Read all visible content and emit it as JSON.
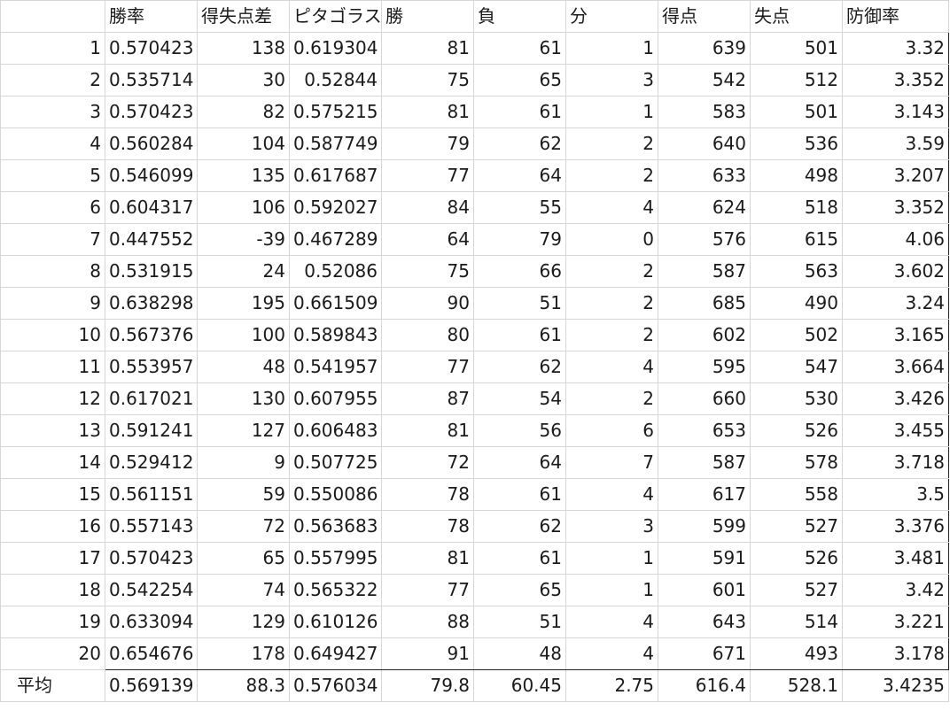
{
  "columns": [
    "勝率",
    "得失点差",
    "ピタゴラス",
    "勝",
    "負",
    "分",
    "得点",
    "失点",
    "防御率"
  ],
  "rows": [
    {
      "label": "1",
      "cells": [
        "0.570423",
        "138",
        "0.619304",
        "81",
        "61",
        "1",
        "639",
        "501",
        "3.32"
      ]
    },
    {
      "label": "2",
      "cells": [
        "0.535714",
        "30",
        "0.52844",
        "75",
        "65",
        "3",
        "542",
        "512",
        "3.352"
      ]
    },
    {
      "label": "3",
      "cells": [
        "0.570423",
        "82",
        "0.575215",
        "81",
        "61",
        "1",
        "583",
        "501",
        "3.143"
      ]
    },
    {
      "label": "4",
      "cells": [
        "0.560284",
        "104",
        "0.587749",
        "79",
        "62",
        "2",
        "640",
        "536",
        "3.59"
      ]
    },
    {
      "label": "5",
      "cells": [
        "0.546099",
        "135",
        "0.617687",
        "77",
        "64",
        "2",
        "633",
        "498",
        "3.207"
      ]
    },
    {
      "label": "6",
      "cells": [
        "0.604317",
        "106",
        "0.592027",
        "84",
        "55",
        "4",
        "624",
        "518",
        "3.352"
      ]
    },
    {
      "label": "7",
      "cells": [
        "0.447552",
        "-39",
        "0.467289",
        "64",
        "79",
        "0",
        "576",
        "615",
        "4.06"
      ]
    },
    {
      "label": "8",
      "cells": [
        "0.531915",
        "24",
        "0.52086",
        "75",
        "66",
        "2",
        "587",
        "563",
        "3.602"
      ]
    },
    {
      "label": "9",
      "cells": [
        "0.638298",
        "195",
        "0.661509",
        "90",
        "51",
        "2",
        "685",
        "490",
        "3.24"
      ]
    },
    {
      "label": "10",
      "cells": [
        "0.567376",
        "100",
        "0.589843",
        "80",
        "61",
        "2",
        "602",
        "502",
        "3.165"
      ]
    },
    {
      "label": "11",
      "cells": [
        "0.553957",
        "48",
        "0.541957",
        "77",
        "62",
        "4",
        "595",
        "547",
        "3.664"
      ]
    },
    {
      "label": "12",
      "cells": [
        "0.617021",
        "130",
        "0.607955",
        "87",
        "54",
        "2",
        "660",
        "530",
        "3.426"
      ]
    },
    {
      "label": "13",
      "cells": [
        "0.591241",
        "127",
        "0.606483",
        "81",
        "56",
        "6",
        "653",
        "526",
        "3.455"
      ]
    },
    {
      "label": "14",
      "cells": [
        "0.529412",
        "9",
        "0.507725",
        "72",
        "64",
        "7",
        "587",
        "578",
        "3.718"
      ]
    },
    {
      "label": "15",
      "cells": [
        "0.561151",
        "59",
        "0.550086",
        "78",
        "61",
        "4",
        "617",
        "558",
        "3.5"
      ]
    },
    {
      "label": "16",
      "cells": [
        "0.557143",
        "72",
        "0.563683",
        "78",
        "62",
        "3",
        "599",
        "527",
        "3.376"
      ]
    },
    {
      "label": "17",
      "cells": [
        "0.570423",
        "65",
        "0.557995",
        "81",
        "61",
        "1",
        "591",
        "526",
        "3.481"
      ]
    },
    {
      "label": "18",
      "cells": [
        "0.542254",
        "74",
        "0.565322",
        "77",
        "65",
        "1",
        "601",
        "527",
        "3.42"
      ]
    },
    {
      "label": "19",
      "cells": [
        "0.633094",
        "129",
        "0.610126",
        "88",
        "51",
        "4",
        "643",
        "514",
        "3.221"
      ]
    },
    {
      "label": "20",
      "cells": [
        "0.654676",
        "178",
        "0.649427",
        "91",
        "48",
        "4",
        "671",
        "493",
        "3.178"
      ]
    }
  ],
  "average": {
    "label": "平均",
    "cells": [
      "0.569139",
      "88.3",
      "0.576034",
      "79.8",
      "60.45",
      "2.75",
      "616.4",
      "528.1",
      "3.4235"
    ]
  }
}
